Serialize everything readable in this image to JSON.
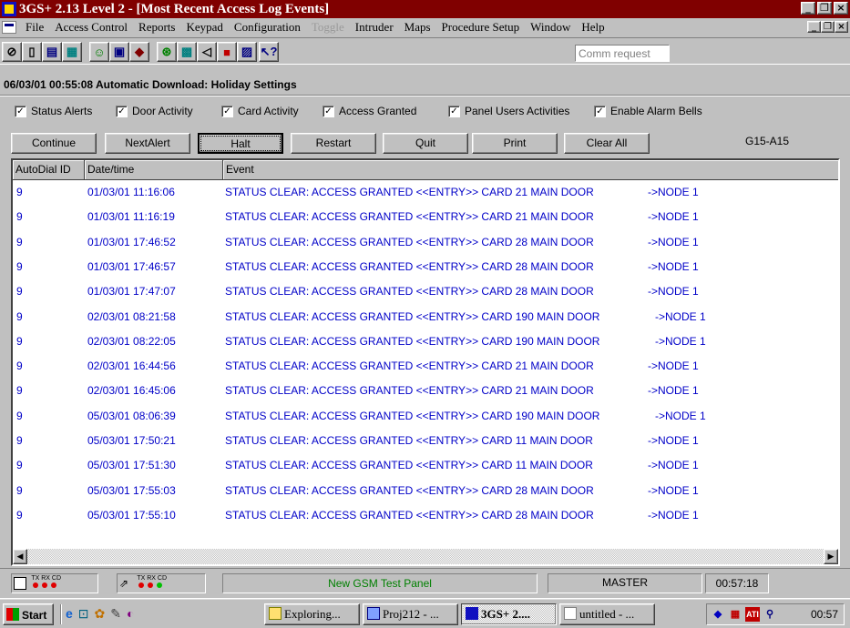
{
  "window": {
    "title": "3GS+ 2.13 Level 2 - [Most Recent Access Log Events]"
  },
  "menu": [
    "File",
    "Access Control",
    "Reports",
    "Keypad",
    "Configuration",
    "Toggle",
    "Intruder",
    "Maps",
    "Procedure Setup",
    "Window",
    "Help"
  ],
  "toolbar": {
    "comm_placeholder": "Comm request"
  },
  "status_line": "06/03/01 00:55:08 Automatic Download: Holiday Settings",
  "checkboxes": [
    {
      "label": "Status Alerts",
      "checked": true
    },
    {
      "label": "Door Activity",
      "checked": true
    },
    {
      "label": "Card Activity",
      "checked": true
    },
    {
      "label": "Access Granted",
      "checked": true
    },
    {
      "label": "Panel Users Activities",
      "checked": true
    },
    {
      "label": "Enable Alarm Bells",
      "checked": true
    }
  ],
  "buttons": [
    "Continue",
    "NextAlert",
    "Halt",
    "Restart",
    "Quit",
    "Print",
    "Clear All"
  ],
  "panel_code": "G15-A15",
  "grid": {
    "headers": [
      "AutoDial ID",
      "Date/time",
      "Event"
    ],
    "rows": [
      {
        "id": "9",
        "datetime": "01/03/01 11:16:06",
        "event": "STATUS CLEAR: ACCESS GRANTED <<ENTRY>> CARD 21 MAIN DOOR",
        "node": "->NODE 1"
      },
      {
        "id": "9",
        "datetime": "01/03/01 11:16:19",
        "event": "STATUS CLEAR: ACCESS GRANTED <<ENTRY>> CARD 21 MAIN DOOR",
        "node": "->NODE 1"
      },
      {
        "id": "9",
        "datetime": "01/03/01 17:46:52",
        "event": "STATUS CLEAR: ACCESS GRANTED <<ENTRY>> CARD 28 MAIN DOOR",
        "node": "->NODE 1"
      },
      {
        "id": "9",
        "datetime": "01/03/01 17:46:57",
        "event": "STATUS CLEAR: ACCESS GRANTED <<ENTRY>> CARD 28 MAIN DOOR",
        "node": "->NODE 1"
      },
      {
        "id": "9",
        "datetime": "01/03/01 17:47:07",
        "event": "STATUS CLEAR: ACCESS GRANTED <<ENTRY>> CARD 28 MAIN DOOR",
        "node": "->NODE 1"
      },
      {
        "id": "9",
        "datetime": "02/03/01 08:21:58",
        "event": "STATUS CLEAR: ACCESS GRANTED <<ENTRY>> CARD 190 MAIN DOOR",
        "node": "->NODE 1"
      },
      {
        "id": "9",
        "datetime": "02/03/01 08:22:05",
        "event": "STATUS CLEAR: ACCESS GRANTED <<ENTRY>> CARD 190 MAIN DOOR",
        "node": "->NODE 1"
      },
      {
        "id": "9",
        "datetime": "02/03/01 16:44:56",
        "event": "STATUS CLEAR: ACCESS GRANTED <<ENTRY>> CARD 21 MAIN DOOR",
        "node": "->NODE 1"
      },
      {
        "id": "9",
        "datetime": "02/03/01 16:45:06",
        "event": "STATUS CLEAR: ACCESS GRANTED <<ENTRY>> CARD 21 MAIN DOOR",
        "node": "->NODE 1"
      },
      {
        "id": "9",
        "datetime": "05/03/01 08:06:39",
        "event": "STATUS CLEAR: ACCESS GRANTED <<ENTRY>> CARD 190 MAIN DOOR",
        "node": "->NODE 1"
      },
      {
        "id": "9",
        "datetime": "05/03/01 17:50:21",
        "event": "STATUS CLEAR: ACCESS GRANTED <<ENTRY>> CARD 11 MAIN DOOR",
        "node": "->NODE 1"
      },
      {
        "id": "9",
        "datetime": "05/03/01 17:51:30",
        "event": "STATUS CLEAR: ACCESS GRANTED <<ENTRY>> CARD 11 MAIN DOOR",
        "node": "->NODE 1"
      },
      {
        "id": "9",
        "datetime": "05/03/01 17:55:03",
        "event": "STATUS CLEAR: ACCESS GRANTED <<ENTRY>> CARD 28 MAIN DOOR",
        "node": "->NODE 1"
      },
      {
        "id": "9",
        "datetime": "05/03/01 17:55:10",
        "event": "STATUS CLEAR: ACCESS GRANTED <<ENTRY>> CARD 28 MAIN DOOR",
        "node": "->NODE 1"
      }
    ]
  },
  "panel_status": {
    "led_label_1": "TX RX CD",
    "led_label_2": "TX RX CD",
    "panel_name": "New GSM Test Panel",
    "user": "MASTER",
    "time": "00:57:18"
  },
  "taskbar": {
    "start": "Start",
    "tasks": [
      "Exploring...",
      "Proj212 - ...",
      "3GS+ 2....",
      "untitled - ..."
    ],
    "clock": "00:57"
  },
  "colors": {
    "title": "#800000",
    "event_text": "#0000c8",
    "panel_name": "#008000"
  }
}
